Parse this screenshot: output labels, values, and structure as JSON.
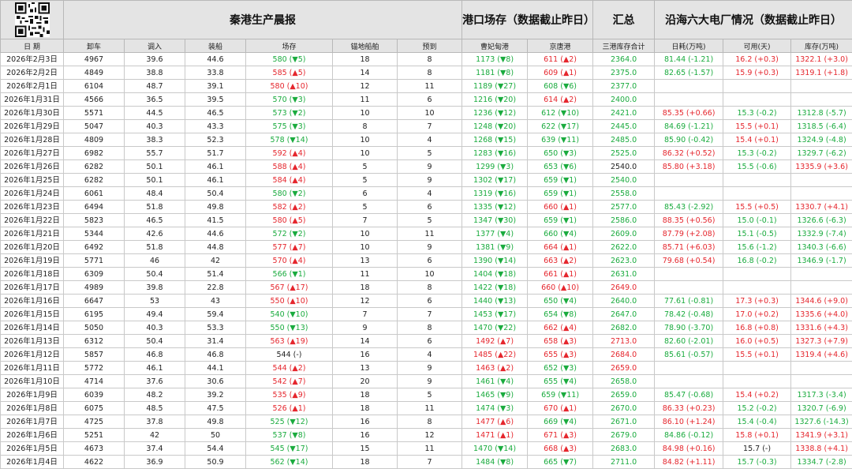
{
  "header": {
    "title": "秦港生产晨报",
    "port_stock_title": "港口场存（数据截止昨日）",
    "summary_title": "汇总",
    "power_title": "沿海六大电厂情况（数据截止昨日）"
  },
  "subheaders": [
    "日 期",
    "卸车",
    "调入",
    "装船",
    "场存",
    "锚地船舶",
    "预到",
    "曹妃甸港",
    "京唐港",
    "三港库存合计",
    "日耗(万吨)",
    "可用(天)",
    "库存(万吨)"
  ],
  "colors": {
    "green": "#1aab3e",
    "red": "#e5262d",
    "header_bg": "#e4e4e4"
  },
  "rows": [
    {
      "date": "2026年2月3日",
      "unload": "4967",
      "in": "39.6",
      "ship": "44.6",
      "stock": {
        "t": "580 (▼5)",
        "c": "g"
      },
      "anchor": "18",
      "expect": "8",
      "cfd": {
        "t": "1173 (▼8)",
        "c": "g"
      },
      "jt": {
        "t": "611 (▲2)",
        "c": "r"
      },
      "total": {
        "t": "2364.0",
        "c": "g"
      },
      "daily": {
        "t": "81.44 (-1.21)",
        "c": "g"
      },
      "days": {
        "t": "16.2 (+0.3)",
        "c": "r"
      },
      "inv": {
        "t": "1322.1 (+3.0)",
        "c": "r"
      }
    },
    {
      "date": "2026年2月2日",
      "unload": "4849",
      "in": "38.8",
      "ship": "33.8",
      "stock": {
        "t": "585 (▲5)",
        "c": "r"
      },
      "anchor": "14",
      "expect": "8",
      "cfd": {
        "t": "1181 (▼8)",
        "c": "g"
      },
      "jt": {
        "t": "609 (▲1)",
        "c": "r"
      },
      "total": {
        "t": "2375.0",
        "c": "g"
      },
      "daily": {
        "t": "82.65 (-1.57)",
        "c": "g"
      },
      "days": {
        "t": "15.9 (+0.3)",
        "c": "r"
      },
      "inv": {
        "t": "1319.1 (+1.8)",
        "c": "r"
      }
    },
    {
      "date": "2026年2月1日",
      "unload": "6104",
      "in": "48.7",
      "ship": "39.1",
      "stock": {
        "t": "580 (▲10)",
        "c": "r"
      },
      "anchor": "12",
      "expect": "11",
      "cfd": {
        "t": "1189 (▼27)",
        "c": "g"
      },
      "jt": {
        "t": "608 (▼6)",
        "c": "g"
      },
      "total": {
        "t": "2377.0",
        "c": "g"
      },
      "daily": {
        "t": "",
        "c": "k"
      },
      "days": {
        "t": "",
        "c": "k"
      },
      "inv": {
        "t": "",
        "c": "k"
      }
    },
    {
      "date": "2026年1月31日",
      "unload": "4566",
      "in": "36.5",
      "ship": "39.5",
      "stock": {
        "t": "570 (▼3)",
        "c": "g"
      },
      "anchor": "11",
      "expect": "6",
      "cfd": {
        "t": "1216 (▼20)",
        "c": "g"
      },
      "jt": {
        "t": "614 (▲2)",
        "c": "r"
      },
      "total": {
        "t": "2400.0",
        "c": "g"
      },
      "daily": {
        "t": "",
        "c": "k"
      },
      "days": {
        "t": "",
        "c": "k"
      },
      "inv": {
        "t": "",
        "c": "k"
      }
    },
    {
      "date": "2026年1月30日",
      "unload": "5571",
      "in": "44.5",
      "ship": "46.5",
      "stock": {
        "t": "573 (▼2)",
        "c": "g"
      },
      "anchor": "10",
      "expect": "10",
      "cfd": {
        "t": "1236 (▼12)",
        "c": "g"
      },
      "jt": {
        "t": "612 (▼10)",
        "c": "g"
      },
      "total": {
        "t": "2421.0",
        "c": "g"
      },
      "daily": {
        "t": "85.35 (+0.66)",
        "c": "r"
      },
      "days": {
        "t": "15.3 (-0.2)",
        "c": "g"
      },
      "inv": {
        "t": "1312.8 (-5.7)",
        "c": "g"
      }
    },
    {
      "date": "2026年1月29日",
      "unload": "5047",
      "in": "40.3",
      "ship": "43.3",
      "stock": {
        "t": "575 (▼3)",
        "c": "g"
      },
      "anchor": "8",
      "expect": "7",
      "cfd": {
        "t": "1248 (▼20)",
        "c": "g"
      },
      "jt": {
        "t": "622 (▼17)",
        "c": "g"
      },
      "total": {
        "t": "2445.0",
        "c": "g"
      },
      "daily": {
        "t": "84.69 (-1.21)",
        "c": "g"
      },
      "days": {
        "t": "15.5 (+0.1)",
        "c": "r"
      },
      "inv": {
        "t": "1318.5 (-6.4)",
        "c": "g"
      }
    },
    {
      "date": "2026年1月28日",
      "unload": "4809",
      "in": "38.3",
      "ship": "52.3",
      "stock": {
        "t": "578 (▼14)",
        "c": "g"
      },
      "anchor": "10",
      "expect": "4",
      "cfd": {
        "t": "1268 (▼15)",
        "c": "g"
      },
      "jt": {
        "t": "639 (▼11)",
        "c": "g"
      },
      "total": {
        "t": "2485.0",
        "c": "g"
      },
      "daily": {
        "t": "85.90 (-0.42)",
        "c": "g"
      },
      "days": {
        "t": "15.4 (+0.1)",
        "c": "r"
      },
      "inv": {
        "t": "1324.9 (-4.8)",
        "c": "g"
      }
    },
    {
      "date": "2026年1月27日",
      "unload": "6982",
      "in": "55.7",
      "ship": "51.7",
      "stock": {
        "t": "592 (▲4)",
        "c": "r"
      },
      "anchor": "10",
      "expect": "5",
      "cfd": {
        "t": "1283 (▼16)",
        "c": "g"
      },
      "jt": {
        "t": "650 (▼3)",
        "c": "g"
      },
      "total": {
        "t": "2525.0",
        "c": "g"
      },
      "daily": {
        "t": "86.32 (+0.52)",
        "c": "r"
      },
      "days": {
        "t": "15.3 (-0.2)",
        "c": "g"
      },
      "inv": {
        "t": "1329.7 (-6.2)",
        "c": "g"
      }
    },
    {
      "date": "2026年1月26日",
      "unload": "6282",
      "in": "50.1",
      "ship": "46.1",
      "stock": {
        "t": "588 (▲4)",
        "c": "r"
      },
      "anchor": "5",
      "expect": "9",
      "cfd": {
        "t": "1299 (▼3)",
        "c": "g"
      },
      "jt": {
        "t": "653 (▼6)",
        "c": "g"
      },
      "total": {
        "t": "2540.0",
        "c": "k"
      },
      "daily": {
        "t": "85.80 (+3.18)",
        "c": "r"
      },
      "days": {
        "t": "15.5 (-0.6)",
        "c": "g"
      },
      "inv": {
        "t": "1335.9 (+3.6)",
        "c": "r"
      }
    },
    {
      "date": "2026年1月25日",
      "unload": "6282",
      "in": "50.1",
      "ship": "46.1",
      "stock": {
        "t": "584 (▲4)",
        "c": "r"
      },
      "anchor": "5",
      "expect": "9",
      "cfd": {
        "t": "1302 (▼17)",
        "c": "g"
      },
      "jt": {
        "t": "659 (▼1)",
        "c": "g"
      },
      "total": {
        "t": "2540.0",
        "c": "g"
      },
      "daily": {
        "t": "",
        "c": "k"
      },
      "days": {
        "t": "",
        "c": "k"
      },
      "inv": {
        "t": "",
        "c": "k"
      }
    },
    {
      "date": "2026年1月24日",
      "unload": "6061",
      "in": "48.4",
      "ship": "50.4",
      "stock": {
        "t": "580 (▼2)",
        "c": "g"
      },
      "anchor": "6",
      "expect": "4",
      "cfd": {
        "t": "1319 (▼16)",
        "c": "g"
      },
      "jt": {
        "t": "659 (▼1)",
        "c": "g"
      },
      "total": {
        "t": "2558.0",
        "c": "g"
      },
      "daily": {
        "t": "",
        "c": "k"
      },
      "days": {
        "t": "",
        "c": "k"
      },
      "inv": {
        "t": "",
        "c": "k"
      }
    },
    {
      "date": "2026年1月23日",
      "unload": "6494",
      "in": "51.8",
      "ship": "49.8",
      "stock": {
        "t": "582 (▲2)",
        "c": "r"
      },
      "anchor": "5",
      "expect": "6",
      "cfd": {
        "t": "1335 (▼12)",
        "c": "g"
      },
      "jt": {
        "t": "660 (▲1)",
        "c": "r"
      },
      "total": {
        "t": "2577.0",
        "c": "g"
      },
      "daily": {
        "t": "85.43 (-2.92)",
        "c": "g"
      },
      "days": {
        "t": "15.5 (+0.5)",
        "c": "r"
      },
      "inv": {
        "t": "1330.7 (+4.1)",
        "c": "r"
      }
    },
    {
      "date": "2026年1月22日",
      "unload": "5823",
      "in": "46.5",
      "ship": "41.5",
      "stock": {
        "t": "580 (▲5)",
        "c": "r"
      },
      "anchor": "7",
      "expect": "5",
      "cfd": {
        "t": "1347 (▼30)",
        "c": "g"
      },
      "jt": {
        "t": "659 (▼1)",
        "c": "g"
      },
      "total": {
        "t": "2586.0",
        "c": "g"
      },
      "daily": {
        "t": "88.35 (+0.56)",
        "c": "r"
      },
      "days": {
        "t": "15.0 (-0.1)",
        "c": "g"
      },
      "inv": {
        "t": "1326.6 (-6.3)",
        "c": "g"
      }
    },
    {
      "date": "2026年1月21日",
      "unload": "5344",
      "in": "42.6",
      "ship": "44.6",
      "stock": {
        "t": "572 (▼2)",
        "c": "g"
      },
      "anchor": "10",
      "expect": "11",
      "cfd": {
        "t": "1377 (▼4)",
        "c": "g"
      },
      "jt": {
        "t": "660 (▼4)",
        "c": "g"
      },
      "total": {
        "t": "2609.0",
        "c": "g"
      },
      "daily": {
        "t": "87.79 (+2.08)",
        "c": "r"
      },
      "days": {
        "t": "15.1 (-0.5)",
        "c": "g"
      },
      "inv": {
        "t": "1332.9 (-7.4)",
        "c": "g"
      }
    },
    {
      "date": "2026年1月20日",
      "unload": "6492",
      "in": "51.8",
      "ship": "44.8",
      "stock": {
        "t": "577 (▲7)",
        "c": "r"
      },
      "anchor": "10",
      "expect": "9",
      "cfd": {
        "t": "1381 (▼9)",
        "c": "g"
      },
      "jt": {
        "t": "664 (▲1)",
        "c": "r"
      },
      "total": {
        "t": "2622.0",
        "c": "g"
      },
      "daily": {
        "t": "85.71 (+6.03)",
        "c": "r"
      },
      "days": {
        "t": "15.6 (-1.2)",
        "c": "g"
      },
      "inv": {
        "t": "1340.3 (-6.6)",
        "c": "g"
      }
    },
    {
      "date": "2026年1月19日",
      "unload": "5771",
      "in": "46",
      "ship": "42",
      "stock": {
        "t": "570 (▲4)",
        "c": "r"
      },
      "anchor": "13",
      "expect": "6",
      "cfd": {
        "t": "1390 (▼14)",
        "c": "g"
      },
      "jt": {
        "t": "663 (▲2)",
        "c": "r"
      },
      "total": {
        "t": "2623.0",
        "c": "g"
      },
      "daily": {
        "t": "79.68 (+0.54)",
        "c": "r"
      },
      "days": {
        "t": "16.8 (-0.2)",
        "c": "g"
      },
      "inv": {
        "t": "1346.9 (-1.7)",
        "c": "g"
      }
    },
    {
      "date": "2026年1月18日",
      "unload": "6309",
      "in": "50.4",
      "ship": "51.4",
      "stock": {
        "t": "566 (▼1)",
        "c": "g"
      },
      "anchor": "11",
      "expect": "10",
      "cfd": {
        "t": "1404 (▼18)",
        "c": "g"
      },
      "jt": {
        "t": "661 (▲1)",
        "c": "r"
      },
      "total": {
        "t": "2631.0",
        "c": "g"
      },
      "daily": {
        "t": "",
        "c": "k"
      },
      "days": {
        "t": "",
        "c": "k"
      },
      "inv": {
        "t": "",
        "c": "k"
      }
    },
    {
      "date": "2026年1月17日",
      "unload": "4989",
      "in": "39.8",
      "ship": "22.8",
      "stock": {
        "t": "567 (▲17)",
        "c": "r"
      },
      "anchor": "18",
      "expect": "8",
      "cfd": {
        "t": "1422 (▼18)",
        "c": "g"
      },
      "jt": {
        "t": "660 (▲10)",
        "c": "r"
      },
      "total": {
        "t": "2649.0",
        "c": "r"
      },
      "daily": {
        "t": "",
        "c": "k"
      },
      "days": {
        "t": "",
        "c": "k"
      },
      "inv": {
        "t": "",
        "c": "k"
      }
    },
    {
      "date": "2026年1月16日",
      "unload": "6647",
      "in": "53",
      "ship": "43",
      "stock": {
        "t": "550 (▲10)",
        "c": "r"
      },
      "anchor": "12",
      "expect": "6",
      "cfd": {
        "t": "1440 (▼13)",
        "c": "g"
      },
      "jt": {
        "t": "650 (▼4)",
        "c": "g"
      },
      "total": {
        "t": "2640.0",
        "c": "g"
      },
      "daily": {
        "t": "77.61 (-0.81)",
        "c": "g"
      },
      "days": {
        "t": "17.3 (+0.3)",
        "c": "r"
      },
      "inv": {
        "t": "1344.6 (+9.0)",
        "c": "r"
      }
    },
    {
      "date": "2026年1月15日",
      "unload": "6195",
      "in": "49.4",
      "ship": "59.4",
      "stock": {
        "t": "540 (▼10)",
        "c": "g"
      },
      "anchor": "7",
      "expect": "7",
      "cfd": {
        "t": "1453 (▼17)",
        "c": "g"
      },
      "jt": {
        "t": "654 (▼8)",
        "c": "g"
      },
      "total": {
        "t": "2647.0",
        "c": "g"
      },
      "daily": {
        "t": "78.42 (-0.48)",
        "c": "g"
      },
      "days": {
        "t": "17.0 (+0.2)",
        "c": "r"
      },
      "inv": {
        "t": "1335.6 (+4.0)",
        "c": "r"
      }
    },
    {
      "date": "2026年1月14日",
      "unload": "5050",
      "in": "40.3",
      "ship": "53.3",
      "stock": {
        "t": "550 (▼13)",
        "c": "g"
      },
      "anchor": "9",
      "expect": "8",
      "cfd": {
        "t": "1470 (▼22)",
        "c": "g"
      },
      "jt": {
        "t": "662 (▲4)",
        "c": "r"
      },
      "total": {
        "t": "2682.0",
        "c": "g"
      },
      "daily": {
        "t": "78.90 (-3.70)",
        "c": "g"
      },
      "days": {
        "t": "16.8 (+0.8)",
        "c": "r"
      },
      "inv": {
        "t": "1331.6 (+4.3)",
        "c": "r"
      }
    },
    {
      "date": "2026年1月13日",
      "unload": "6312",
      "in": "50.4",
      "ship": "31.4",
      "stock": {
        "t": "563 (▲19)",
        "c": "r"
      },
      "anchor": "14",
      "expect": "6",
      "cfd": {
        "t": "1492 (▲7)",
        "c": "r"
      },
      "jt": {
        "t": "658 (▲3)",
        "c": "r"
      },
      "total": {
        "t": "2713.0",
        "c": "r"
      },
      "daily": {
        "t": "82.60 (-2.01)",
        "c": "g"
      },
      "days": {
        "t": "16.0 (+0.5)",
        "c": "r"
      },
      "inv": {
        "t": "1327.3 (+7.9)",
        "c": "r"
      }
    },
    {
      "date": "2026年1月12日",
      "unload": "5857",
      "in": "46.8",
      "ship": "46.8",
      "stock": {
        "t": "544 (-)",
        "c": "k"
      },
      "anchor": "16",
      "expect": "4",
      "cfd": {
        "t": "1485 (▲22)",
        "c": "r"
      },
      "jt": {
        "t": "655 (▲3)",
        "c": "r"
      },
      "total": {
        "t": "2684.0",
        "c": "r"
      },
      "daily": {
        "t": "85.61 (-0.57)",
        "c": "g"
      },
      "days": {
        "t": "15.5 (+0.1)",
        "c": "r"
      },
      "inv": {
        "t": "1319.4 (+4.6)",
        "c": "r"
      }
    },
    {
      "date": "2026年1月11日",
      "unload": "5772",
      "in": "46.1",
      "ship": "44.1",
      "stock": {
        "t": "544 (▲2)",
        "c": "r"
      },
      "anchor": "13",
      "expect": "9",
      "cfd": {
        "t": "1463 (▲2)",
        "c": "r"
      },
      "jt": {
        "t": "652 (▼3)",
        "c": "g"
      },
      "total": {
        "t": "2659.0",
        "c": "r"
      },
      "daily": {
        "t": "",
        "c": "k"
      },
      "days": {
        "t": "",
        "c": "k"
      },
      "inv": {
        "t": "",
        "c": "k"
      }
    },
    {
      "date": "2026年1月10日",
      "unload": "4714",
      "in": "37.6",
      "ship": "30.6",
      "stock": {
        "t": "542 (▲7)",
        "c": "r"
      },
      "anchor": "20",
      "expect": "9",
      "cfd": {
        "t": "1461 (▼4)",
        "c": "g"
      },
      "jt": {
        "t": "655 (▼4)",
        "c": "g"
      },
      "total": {
        "t": "2658.0",
        "c": "g"
      },
      "daily": {
        "t": "",
        "c": "k"
      },
      "days": {
        "t": "",
        "c": "k"
      },
      "inv": {
        "t": "",
        "c": "k"
      }
    },
    {
      "date": "2026年1月9日",
      "unload": "6039",
      "in": "48.2",
      "ship": "39.2",
      "stock": {
        "t": "535 (▲9)",
        "c": "r"
      },
      "anchor": "18",
      "expect": "5",
      "cfd": {
        "t": "1465 (▼9)",
        "c": "g"
      },
      "jt": {
        "t": "659 (▼11)",
        "c": "g"
      },
      "total": {
        "t": "2659.0",
        "c": "g"
      },
      "daily": {
        "t": "85.47 (-0.68)",
        "c": "g"
      },
      "days": {
        "t": "15.4 (+0.2)",
        "c": "r"
      },
      "inv": {
        "t": "1317.3 (-3.4)",
        "c": "g"
      }
    },
    {
      "date": "2026年1月8日",
      "unload": "6075",
      "in": "48.5",
      "ship": "47.5",
      "stock": {
        "t": "526 (▲1)",
        "c": "r"
      },
      "anchor": "18",
      "expect": "11",
      "cfd": {
        "t": "1474 (▼3)",
        "c": "g"
      },
      "jt": {
        "t": "670 (▲1)",
        "c": "r"
      },
      "total": {
        "t": "2670.0",
        "c": "g"
      },
      "daily": {
        "t": "86.33 (+0.23)",
        "c": "r"
      },
      "days": {
        "t": "15.2 (-0.2)",
        "c": "g"
      },
      "inv": {
        "t": "1320.7 (-6.9)",
        "c": "g"
      }
    },
    {
      "date": "2026年1月7日",
      "unload": "4725",
      "in": "37.8",
      "ship": "49.8",
      "stock": {
        "t": "525 (▼12)",
        "c": "g"
      },
      "anchor": "16",
      "expect": "8",
      "cfd": {
        "t": "1477 (▲6)",
        "c": "r"
      },
      "jt": {
        "t": "669 (▼4)",
        "c": "g"
      },
      "total": {
        "t": "2671.0",
        "c": "g"
      },
      "daily": {
        "t": "86.10 (+1.24)",
        "c": "r"
      },
      "days": {
        "t": "15.4 (-0.4)",
        "c": "g"
      },
      "inv": {
        "t": "1327.6 (-14.3)",
        "c": "g"
      }
    },
    {
      "date": "2026年1月6日",
      "unload": "5251",
      "in": "42",
      "ship": "50",
      "stock": {
        "t": "537 (▼8)",
        "c": "g"
      },
      "anchor": "16",
      "expect": "12",
      "cfd": {
        "t": "1471 (▲1)",
        "c": "r"
      },
      "jt": {
        "t": "671 (▲3)",
        "c": "r"
      },
      "total": {
        "t": "2679.0",
        "c": "g"
      },
      "daily": {
        "t": "84.86 (-0.12)",
        "c": "g"
      },
      "days": {
        "t": "15.8 (+0.1)",
        "c": "r"
      },
      "inv": {
        "t": "1341.9 (+3.1)",
        "c": "r"
      }
    },
    {
      "date": "2026年1月5日",
      "unload": "4673",
      "in": "37.4",
      "ship": "54.4",
      "stock": {
        "t": "545 (▼17)",
        "c": "g"
      },
      "anchor": "15",
      "expect": "11",
      "cfd": {
        "t": "1470 (▼14)",
        "c": "g"
      },
      "jt": {
        "t": "668 (▲3)",
        "c": "r"
      },
      "total": {
        "t": "2683.0",
        "c": "g"
      },
      "daily": {
        "t": "84.98 (+0.16)",
        "c": "r"
      },
      "days": {
        "t": "15.7 (-)",
        "c": "k"
      },
      "inv": {
        "t": "1338.8 (+4.1)",
        "c": "r"
      }
    },
    {
      "date": "2026年1月4日",
      "unload": "4622",
      "in": "36.9",
      "ship": "50.9",
      "stock": {
        "t": "562 (▼14)",
        "c": "g"
      },
      "anchor": "18",
      "expect": "7",
      "cfd": {
        "t": "1484 (▼8)",
        "c": "g"
      },
      "jt": {
        "t": "665 (▼7)",
        "c": "g"
      },
      "total": {
        "t": "2711.0",
        "c": "g"
      },
      "daily": {
        "t": "84.82 (+1.11)",
        "c": "r"
      },
      "days": {
        "t": "15.7 (-0.3)",
        "c": "g"
      },
      "inv": {
        "t": "1334.7 (-2.8)",
        "c": "g"
      }
    }
  ]
}
